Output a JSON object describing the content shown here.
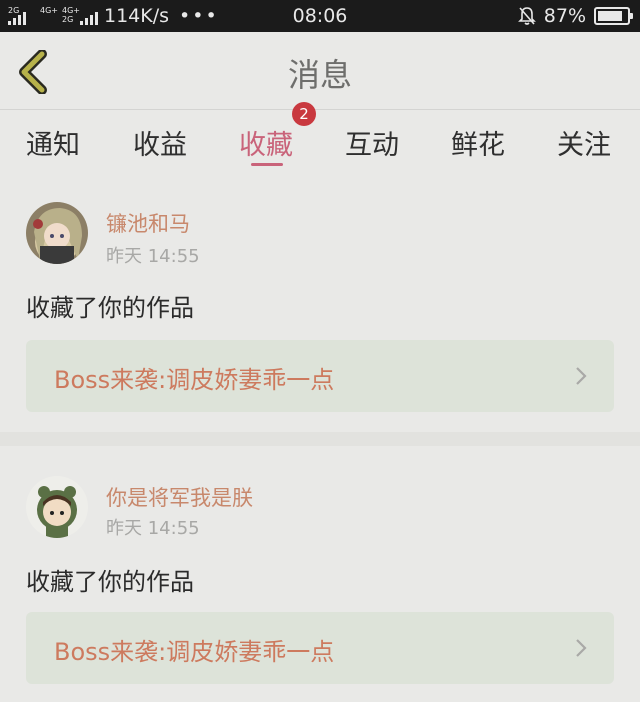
{
  "status_bar": {
    "signal_tag_1": "2G",
    "signal_tag_2": "4G+",
    "signal_tag_3": "4G+",
    "signal_tag_4": "2G",
    "net_speed": "114K/s",
    "dots": "•••",
    "time": "08:06",
    "battery": "87%",
    "battery_level": 0.87
  },
  "header": {
    "back_icon": "chevron-left-icon",
    "title": "消息"
  },
  "tabs": [
    {
      "label": "通知"
    },
    {
      "label": "收益"
    },
    {
      "label": "收藏"
    },
    {
      "label": "互动"
    },
    {
      "label": "鲜花"
    },
    {
      "label": "关注"
    }
  ],
  "active_tab": "收藏",
  "badge": "2",
  "messages": [
    {
      "username": "镰池和马",
      "time": "昨天 14:55",
      "action": "收藏了你的作品",
      "work_title": "Boss来袭:调皮娇妻乖一点"
    },
    {
      "username": "你是将军我是朕",
      "time": "昨天 14:55",
      "action": "收藏了你的作品",
      "work_title": "Boss来袭:调皮娇妻乖一点"
    }
  ],
  "colors": {
    "accent": "#c9637a",
    "badge": "#c9393f",
    "username": "#c8886c",
    "work_title": "#cd7a5e",
    "link_bg": "#dde3d9"
  }
}
